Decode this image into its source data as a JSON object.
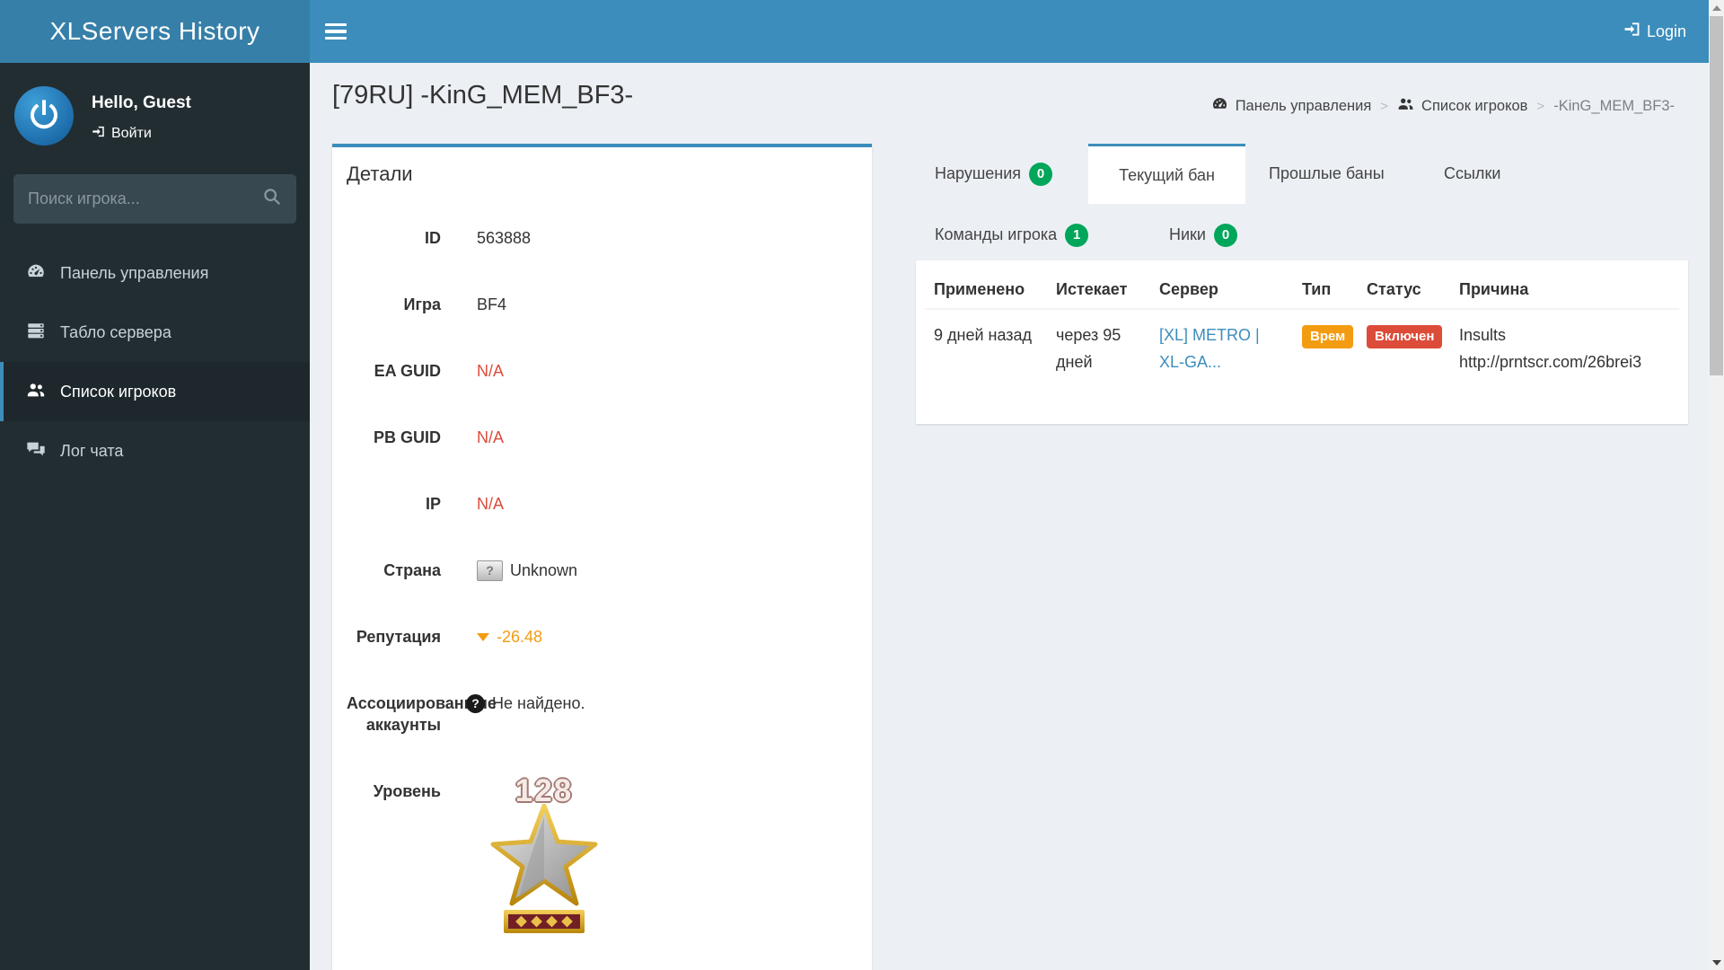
{
  "topbar": {
    "brand": "XLServers History",
    "login": "Login"
  },
  "sidebar": {
    "greeting": "Hello, Guest",
    "login_link": "Войти",
    "search_placeholder": "Поиск игрока...",
    "items": [
      {
        "label": "Панель управления"
      },
      {
        "label": "Табло сервера"
      },
      {
        "label": "Список игроков"
      },
      {
        "label": "Лог чата"
      }
    ]
  },
  "page": {
    "title": "[79RU] -KinG_MEM_BF3-",
    "breadcrumb": [
      {
        "label": "Панель управления"
      },
      {
        "label": "Список игроков"
      },
      {
        "label": "-KinG_MEM_BF3-"
      }
    ]
  },
  "details": {
    "title": "Детали",
    "fields": [
      {
        "label": "ID",
        "value": "563888"
      },
      {
        "label": "Игра",
        "value": "BF4"
      },
      {
        "label": "EA GUID",
        "value": "N/A"
      },
      {
        "label": "PB GUID",
        "value": "N/A"
      },
      {
        "label": "IP",
        "value": "N/A"
      },
      {
        "label": "Страна",
        "value": "Unknown",
        "flag": "?"
      },
      {
        "label": "Репутация",
        "value": "-26.48"
      },
      {
        "label": "Ассоциированные аккаунты",
        "value": "Не найдено."
      },
      {
        "label": "Уровень",
        "value": "128"
      }
    ]
  },
  "tabs": {
    "row1": [
      {
        "label": "Нарушения",
        "badge": "0"
      },
      {
        "label": "Текущий бан"
      },
      {
        "label": "Прошлые баны"
      },
      {
        "label": "Ссылки"
      }
    ],
    "row2": [
      {
        "label": "Команды игрока",
        "badge": "1"
      },
      {
        "label": "Ники",
        "badge": "0"
      }
    ]
  },
  "ban_table": {
    "headers": [
      "Применено",
      "Истекает",
      "Сервер",
      "Тип",
      "Статус",
      "Причина"
    ],
    "rows": [
      {
        "applied": "9 дней назад",
        "expires": "через 95 дней",
        "server": "[XL] METRO | XL-GA...",
        "type": "Врем",
        "status": "Включен",
        "reason_line1": "Insults",
        "reason_line2": "http://prntscr.com/26brei3"
      }
    ]
  },
  "colors": {
    "accent": "#3c8dbc",
    "sidebar_bg": "#222d32",
    "badge_green": "#00a65a",
    "label_orange": "#f39c12",
    "label_red": "#dd4b39",
    "na_red": "#dd4b39"
  }
}
